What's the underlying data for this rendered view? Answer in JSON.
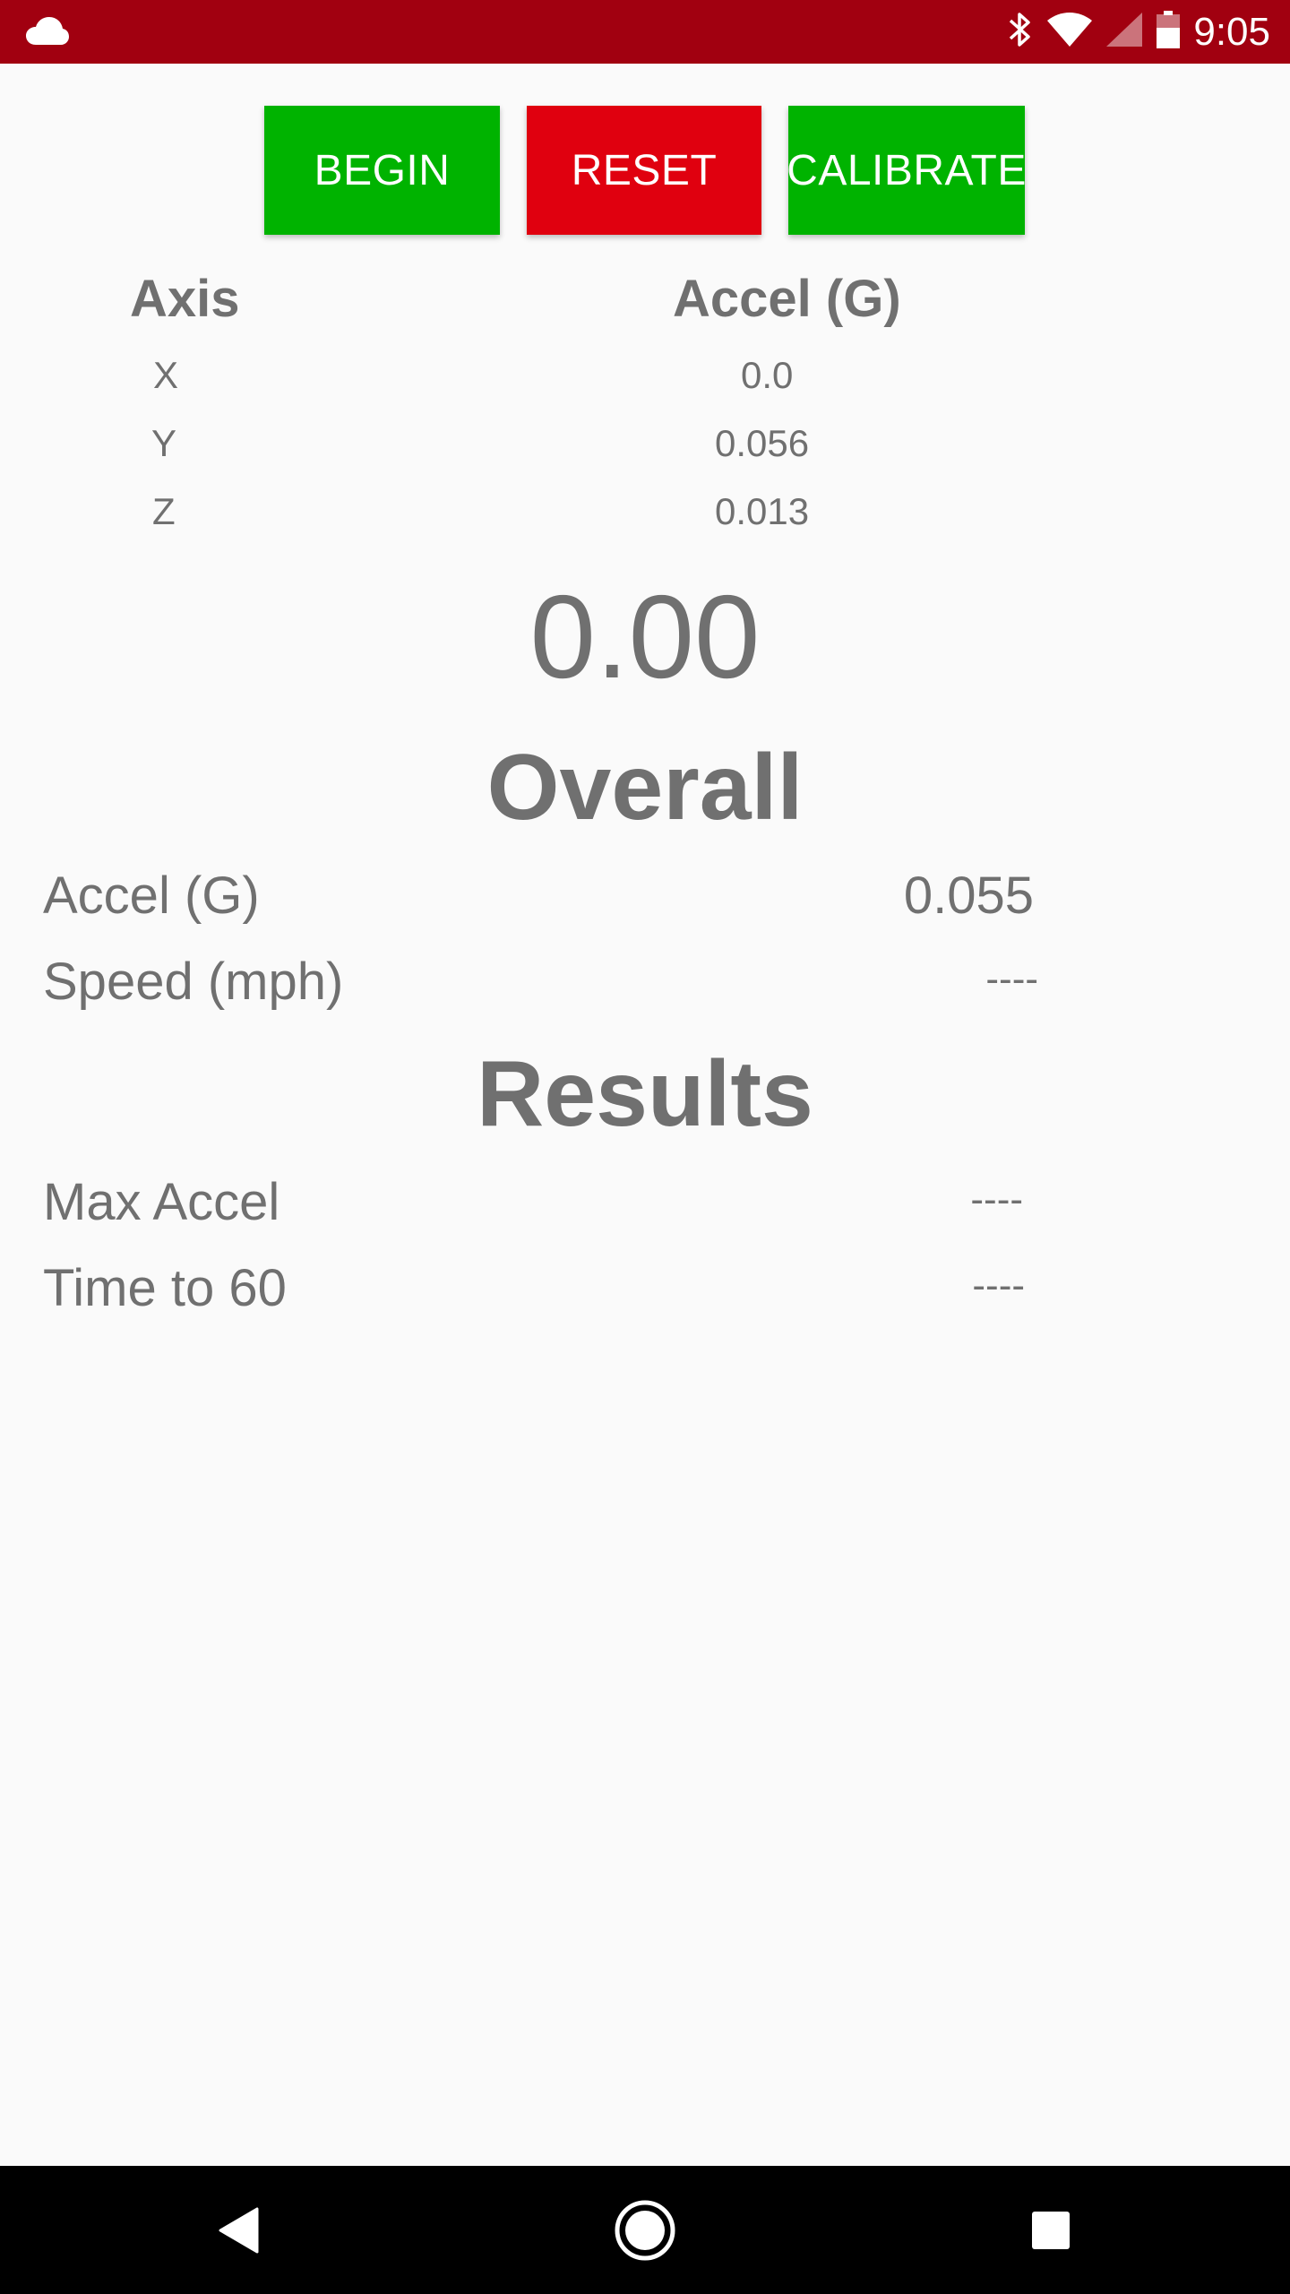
{
  "status_bar": {
    "time": "9:05",
    "icons": [
      "cloud-icon",
      "bluetooth-icon",
      "wifi-icon",
      "signal-icon",
      "battery-icon"
    ],
    "color": "#a10010"
  },
  "buttons": {
    "begin": "BEGIN",
    "reset": "RESET",
    "calibrate": "CALIBRATE",
    "colors": {
      "begin": "#00b300",
      "reset": "#e0000f",
      "calibrate": "#00b300"
    }
  },
  "axis_table": {
    "header_axis": "Axis",
    "header_accel": "Accel (G)",
    "rows": [
      {
        "axis": "X",
        "accel": "0.0"
      },
      {
        "axis": "Y",
        "accel": "0.056"
      },
      {
        "axis": "Z",
        "accel": "0.013"
      }
    ]
  },
  "speed_display": "0.00",
  "overall": {
    "title": "Overall",
    "accel_label": "Accel (G)",
    "accel_value": "0.055",
    "speed_label": "Speed (mph)",
    "speed_value": "----"
  },
  "results": {
    "title": "Results",
    "max_accel_label": "Max Accel",
    "max_accel_value": "----",
    "time_to_60_label": "Time to 60",
    "time_to_60_value": "----"
  },
  "nav_bar": {
    "icons": [
      "back-icon",
      "home-icon",
      "recents-icon"
    ]
  }
}
